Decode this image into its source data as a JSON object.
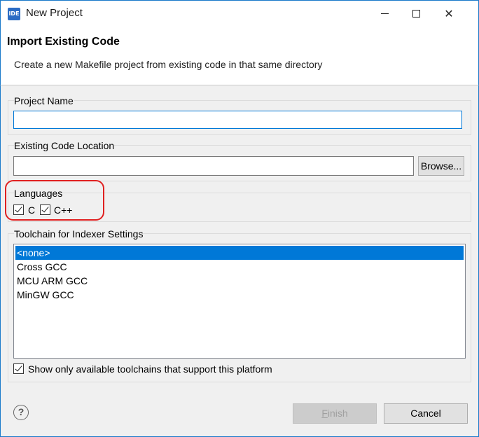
{
  "window": {
    "app_icon_text": "IDE",
    "title": "New Project",
    "minimize_icon": "minimize-icon",
    "maximize_icon": "maximize-icon",
    "close_glyph": "✕"
  },
  "header": {
    "title": "Import Existing Code",
    "description": "Create a new Makefile project from existing code in that same directory"
  },
  "project_name": {
    "label": "Project Name",
    "value": ""
  },
  "code_location": {
    "label": "Existing Code Location",
    "value": "",
    "browse_label": "Browse..."
  },
  "languages": {
    "label": "Languages",
    "items": [
      {
        "label": "C",
        "checked": true
      },
      {
        "label": "C++",
        "checked": true
      }
    ]
  },
  "toolchain": {
    "label": "Toolchain for Indexer Settings",
    "items": [
      "<none>",
      "Cross GCC",
      "MCU ARM GCC",
      "MinGW GCC"
    ],
    "selected_index": 0,
    "filter_label": "Show only available toolchains that support this platform",
    "filter_checked": true
  },
  "footer": {
    "help_glyph": "?",
    "finish_label": "Finish",
    "cancel_label": "Cancel"
  },
  "colors": {
    "accent": "#0078d7",
    "window_border": "#1979ca",
    "annotation": "#e02020"
  }
}
